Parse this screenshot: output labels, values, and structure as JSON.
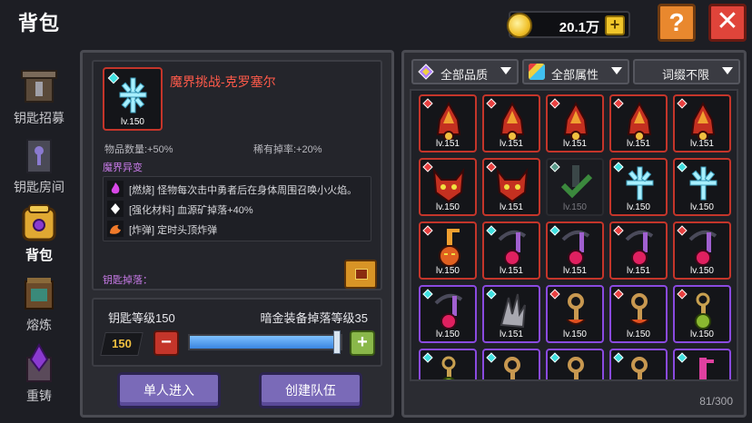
{
  "title": "背包",
  "currency": {
    "value": "20.1万",
    "plus": "+"
  },
  "help": "?",
  "close": "✕",
  "nav": [
    {
      "label": "钥匙招募",
      "icon": "key-recruit-icon"
    },
    {
      "label": "钥匙房间",
      "icon": "key-room-icon"
    },
    {
      "label": "背包",
      "icon": "backpack-icon",
      "active": true
    },
    {
      "label": "熔炼",
      "icon": "smelt-icon"
    },
    {
      "label": "重铸",
      "icon": "recast-icon"
    }
  ],
  "detail": {
    "item_level": "lv.150",
    "item_name": "魔界挑战-克罗塞尔",
    "stat1": "物品数量:+50%",
    "stat2": "稀有掉率:+20%",
    "section": "魔界异变",
    "affixes": [
      {
        "text": "[燃烧] 怪物每次击中勇者后在身体周围召唤小火焰。",
        "color": "#d848e8"
      },
      {
        "text": "[强化材料] 血源矿掉落+40%",
        "color": "#ffffff"
      },
      {
        "text": "[炸弹] 定时头顶炸弹",
        "color": "#f07a2a"
      }
    ],
    "drop_label": "钥匙掉落：",
    "key_level_label": "钥匙等级150",
    "equip_level_label": "暗金装备掉落等级35",
    "level_value": "150",
    "slider_fraction": 0.97,
    "minus": "−",
    "plus": "+",
    "solo_button": "单人进入",
    "team_button": "创建队伍"
  },
  "filters": [
    {
      "label": "全部品质",
      "icon": "quality-gem-icon"
    },
    {
      "label": "全部属性",
      "icon": "attribute-prism-icon"
    },
    {
      "label": "词缀不限",
      "icon": ""
    }
  ],
  "inventory": {
    "count": "81/300",
    "slots": [
      {
        "lv": "lv.151",
        "kind": "red-flame",
        "frame": "red",
        "gem": "#e84040"
      },
      {
        "lv": "lv.151",
        "kind": "red-flame",
        "frame": "red",
        "gem": "#e84040"
      },
      {
        "lv": "lv.151",
        "kind": "red-flame",
        "frame": "red",
        "gem": "#e84040"
      },
      {
        "lv": "lv.151",
        "kind": "red-flame",
        "frame": "red",
        "gem": "#e84040"
      },
      {
        "lv": "lv.151",
        "kind": "red-flame",
        "frame": "red",
        "gem": "#e84040"
      },
      {
        "lv": "lv.150",
        "kind": "demon-mask",
        "frame": "red",
        "gem": "#e84040"
      },
      {
        "lv": "lv.151",
        "kind": "demon-mask",
        "frame": "red",
        "gem": "#e84040"
      },
      {
        "lv": "lv.150",
        "kind": "green-check",
        "frame": "gray",
        "gem": "#5a9a8a"
      },
      {
        "lv": "lv.150",
        "kind": "ice-crystal",
        "frame": "red",
        "gem": "#40e0e0"
      },
      {
        "lv": "lv.150",
        "kind": "ice-crystal",
        "frame": "red",
        "gem": "#40e0e0"
      },
      {
        "lv": "lv.150",
        "kind": "pumpkin-key",
        "frame": "red",
        "gem": "#e84040"
      },
      {
        "lv": "lv.151",
        "kind": "scythe-key",
        "frame": "red",
        "gem": "#40e0e0"
      },
      {
        "lv": "lv.151",
        "kind": "scythe-key",
        "frame": "red",
        "gem": "#40e0e0"
      },
      {
        "lv": "lv.151",
        "kind": "scythe-key",
        "frame": "red",
        "gem": "#e84040"
      },
      {
        "lv": "lv.150",
        "kind": "scythe-key",
        "frame": "red",
        "gem": "#e84040"
      },
      {
        "lv": "lv.150",
        "kind": "scythe-key",
        "frame": "purple",
        "gem": "#40e0e0"
      },
      {
        "lv": "lv.151",
        "kind": "spike-key",
        "frame": "purple",
        "gem": "#40e0e0"
      },
      {
        "lv": "lv.150",
        "kind": "bronze-key",
        "frame": "purple",
        "gem": "#e84040"
      },
      {
        "lv": "lv.150",
        "kind": "bronze-key",
        "frame": "purple",
        "gem": "#e84040"
      },
      {
        "lv": "lv.150",
        "kind": "green-key",
        "frame": "purple",
        "gem": "#e84040"
      },
      {
        "lv": "",
        "kind": "green-key",
        "frame": "purple",
        "gem": "#40e0e0"
      },
      {
        "lv": "",
        "kind": "bronze-key",
        "frame": "purple",
        "gem": "#40e0e0"
      },
      {
        "lv": "",
        "kind": "bronze-key",
        "frame": "purple",
        "gem": "#40e0e0"
      },
      {
        "lv": "",
        "kind": "bronze-key",
        "frame": "purple",
        "gem": "#40e0e0"
      },
      {
        "lv": "",
        "kind": "pink-key",
        "frame": "purple",
        "gem": "#40e0e0"
      }
    ]
  }
}
